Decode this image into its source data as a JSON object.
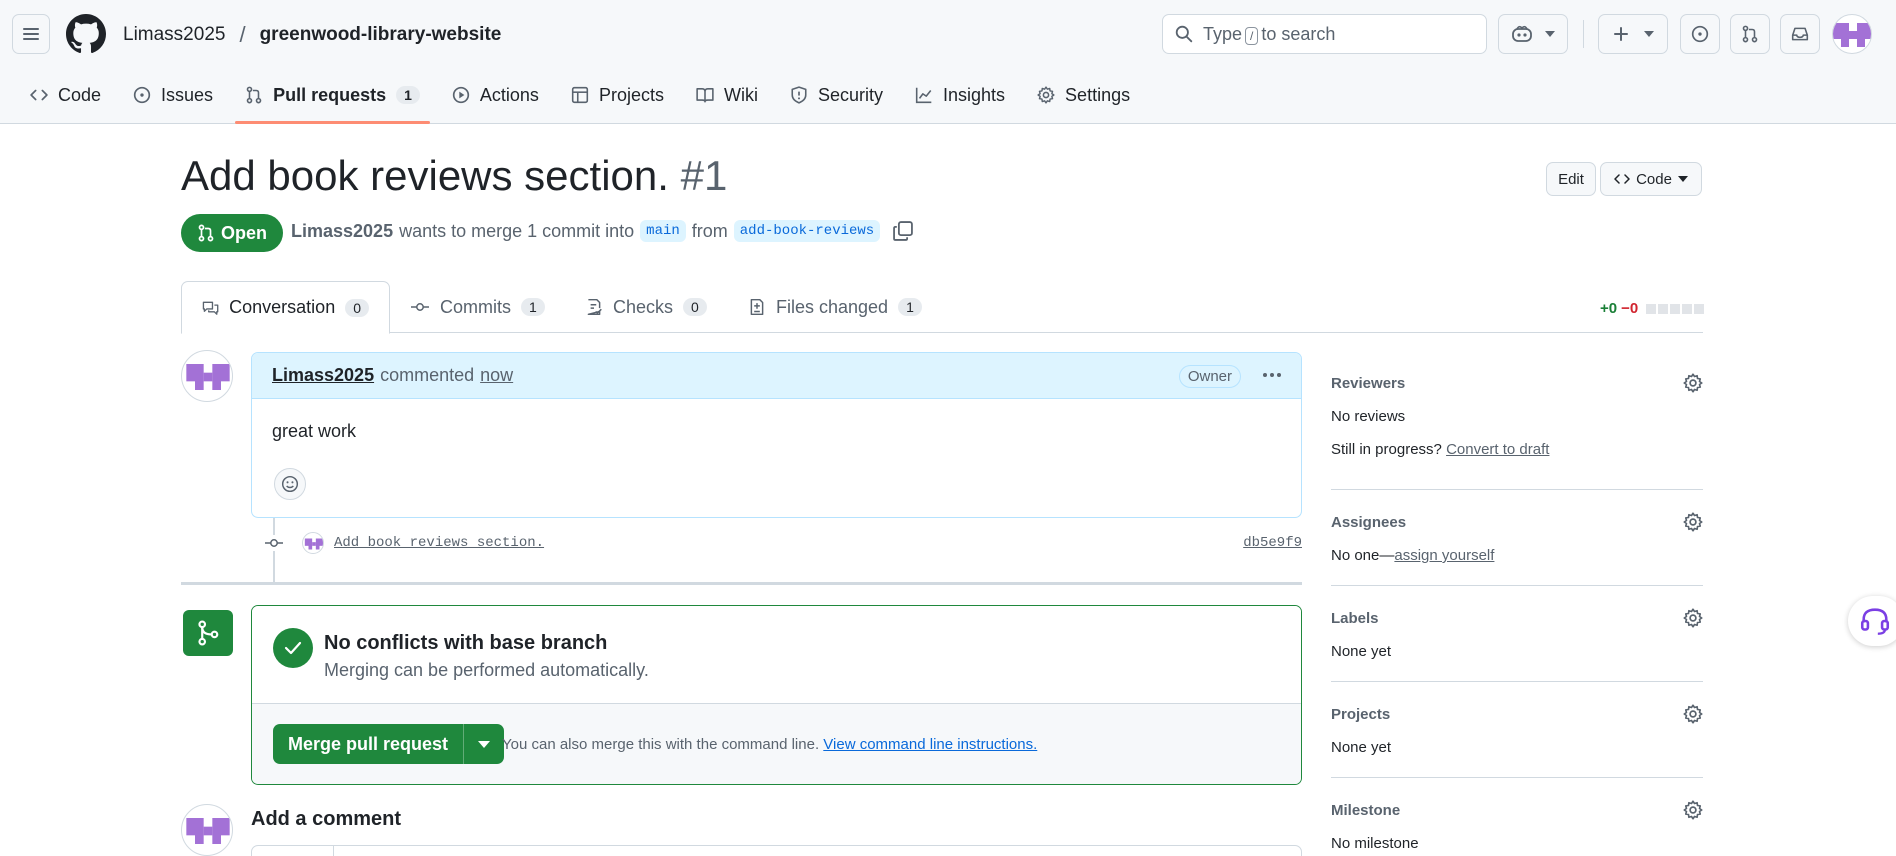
{
  "header": {
    "owner": "Limass2025",
    "separator": "/",
    "repo": "greenwood-library-website",
    "search": {
      "prefix": "Type",
      "key": "/",
      "suffix": "to search"
    }
  },
  "repo_tabs": [
    {
      "label": "Code",
      "icon": "code-icon"
    },
    {
      "label": "Issues",
      "icon": "issue-icon"
    },
    {
      "label": "Pull requests",
      "icon": "pull-request-icon",
      "count": "1",
      "active": true
    },
    {
      "label": "Actions",
      "icon": "play-icon"
    },
    {
      "label": "Projects",
      "icon": "table-icon"
    },
    {
      "label": "Wiki",
      "icon": "book-icon"
    },
    {
      "label": "Security",
      "icon": "shield-icon"
    },
    {
      "label": "Insights",
      "icon": "graph-icon"
    },
    {
      "label": "Settings",
      "icon": "gear-icon"
    }
  ],
  "pr": {
    "title": "Add book reviews section.",
    "number": "#1",
    "state": "Open",
    "author": "Limass2025",
    "meta_text": "wants to merge 1 commit into",
    "base": "main",
    "from": "from",
    "head": "add-book-reviews",
    "edit_label": "Edit",
    "code_label": "Code"
  },
  "pr_tabs": [
    {
      "label": "Conversation",
      "count": "0",
      "active": true
    },
    {
      "label": "Commits",
      "count": "1"
    },
    {
      "label": "Checks",
      "count": "0"
    },
    {
      "label": "Files changed",
      "count": "1"
    }
  ],
  "diffstat": {
    "added": "+0",
    "removed": "−0"
  },
  "comment": {
    "author": "Limass2025",
    "action": "commented",
    "time": "now",
    "badge": "Owner",
    "body": "great work"
  },
  "commit": {
    "message": "Add book reviews section.",
    "sha": "db5e9f9"
  },
  "merge": {
    "title": "No conflicts with base branch",
    "subtitle": "Merging can be performed automatically.",
    "button": "Merge pull request",
    "hint": "You can also merge this with the command line.",
    "hint_link": "View command line instructions."
  },
  "add_comment": "Add a comment",
  "sidebar": {
    "reviewers": {
      "heading": "Reviewers",
      "value": "No reviews",
      "draft_prefix": "Still in progress?",
      "draft_link": "Convert to draft"
    },
    "assignees": {
      "heading": "Assignees",
      "prefix": "No one—",
      "link": "assign yourself"
    },
    "labels": {
      "heading": "Labels",
      "value": "None yet"
    },
    "projects": {
      "heading": "Projects",
      "value": "None yet"
    },
    "milestone": {
      "heading": "Milestone",
      "value": "No milestone"
    }
  },
  "colors": {
    "green": "#1f883d",
    "blue_link": "#0969da",
    "tab_underline": "#fd8c73",
    "avatar": "#a371d6"
  }
}
